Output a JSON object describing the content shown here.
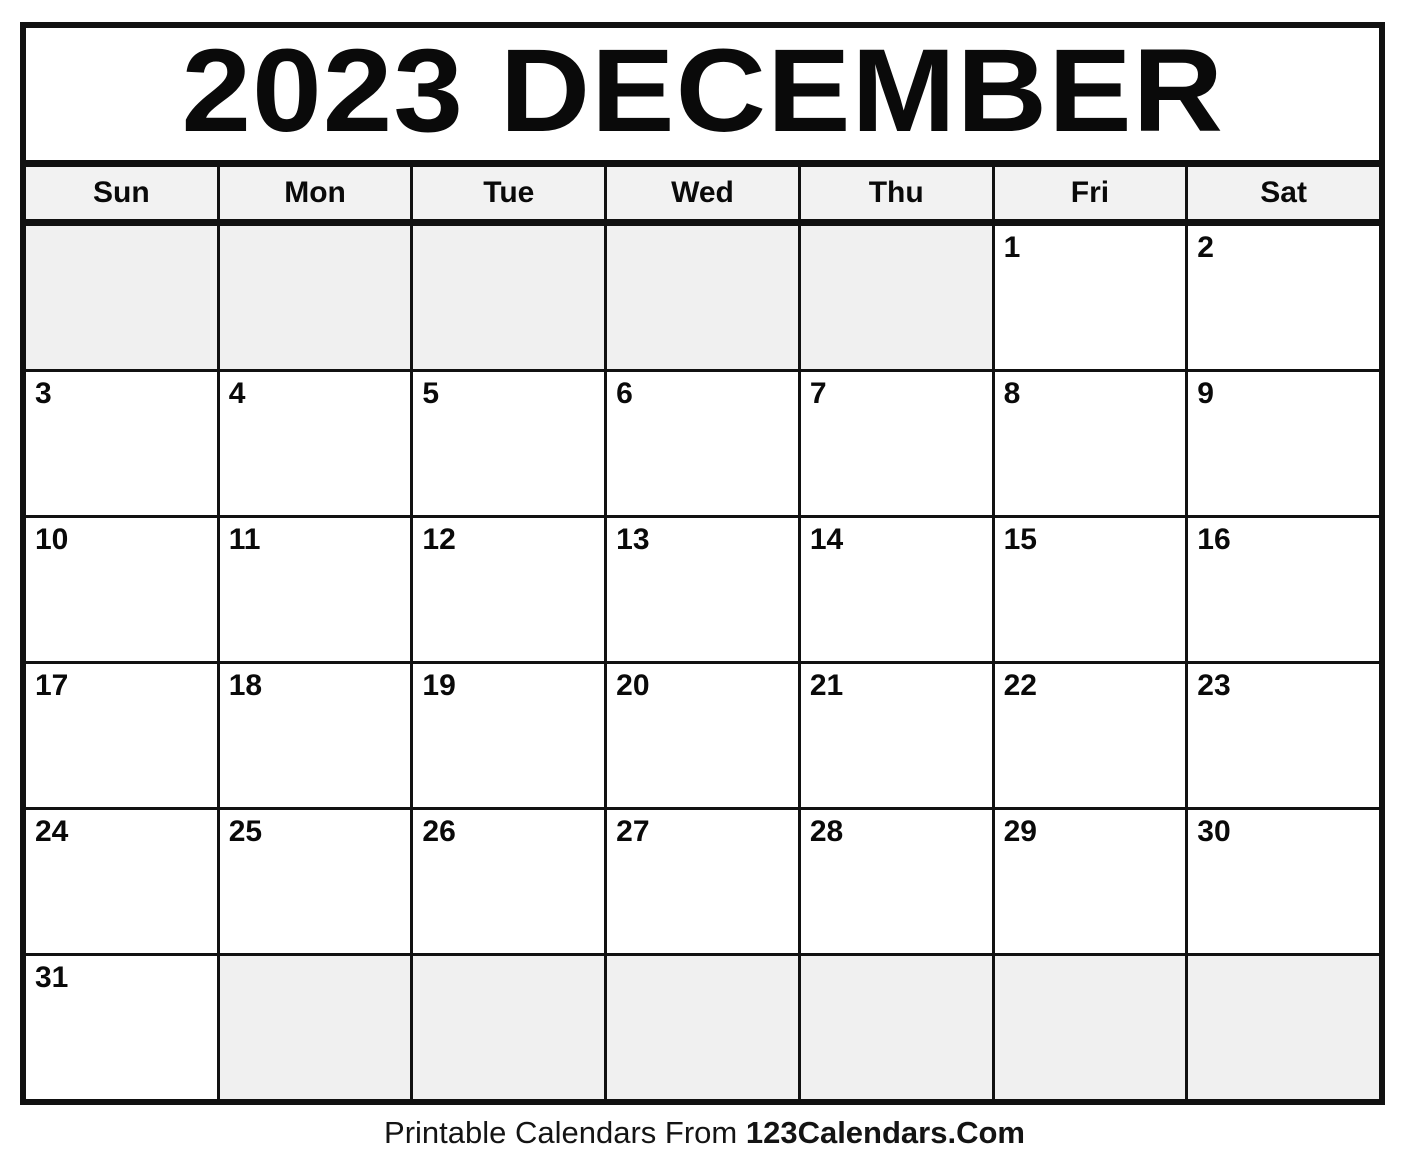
{
  "calendar": {
    "title": "2023 DECEMBER",
    "year": "2023",
    "month": "DECEMBER",
    "weekdays": [
      {
        "label": "Sun"
      },
      {
        "label": "Mon"
      },
      {
        "label": "Tue"
      },
      {
        "label": "Wed"
      },
      {
        "label": "Thu"
      },
      {
        "label": "Fri"
      },
      {
        "label": "Sat"
      }
    ],
    "weeks": [
      [
        {
          "day": "",
          "blank": true
        },
        {
          "day": "",
          "blank": true
        },
        {
          "day": "",
          "blank": true
        },
        {
          "day": "",
          "blank": true
        },
        {
          "day": "",
          "blank": true
        },
        {
          "day": "1",
          "blank": false
        },
        {
          "day": "2",
          "blank": false
        }
      ],
      [
        {
          "day": "3",
          "blank": false
        },
        {
          "day": "4",
          "blank": false
        },
        {
          "day": "5",
          "blank": false
        },
        {
          "day": "6",
          "blank": false
        },
        {
          "day": "7",
          "blank": false
        },
        {
          "day": "8",
          "blank": false
        },
        {
          "day": "9",
          "blank": false
        }
      ],
      [
        {
          "day": "10",
          "blank": false
        },
        {
          "day": "11",
          "blank": false
        },
        {
          "day": "12",
          "blank": false
        },
        {
          "day": "13",
          "blank": false
        },
        {
          "day": "14",
          "blank": false
        },
        {
          "day": "15",
          "blank": false
        },
        {
          "day": "16",
          "blank": false
        }
      ],
      [
        {
          "day": "17",
          "blank": false
        },
        {
          "day": "18",
          "blank": false
        },
        {
          "day": "19",
          "blank": false
        },
        {
          "day": "20",
          "blank": false
        },
        {
          "day": "21",
          "blank": false
        },
        {
          "day": "22",
          "blank": false
        },
        {
          "day": "23",
          "blank": false
        }
      ],
      [
        {
          "day": "24",
          "blank": false
        },
        {
          "day": "25",
          "blank": false
        },
        {
          "day": "26",
          "blank": false
        },
        {
          "day": "27",
          "blank": false
        },
        {
          "day": "28",
          "blank": false
        },
        {
          "day": "29",
          "blank": false
        },
        {
          "day": "30",
          "blank": false
        }
      ],
      [
        {
          "day": "31",
          "blank": false
        },
        {
          "day": "",
          "blank": true
        },
        {
          "day": "",
          "blank": true
        },
        {
          "day": "",
          "blank": true
        },
        {
          "day": "",
          "blank": true
        },
        {
          "day": "",
          "blank": true
        },
        {
          "day": "",
          "blank": true
        }
      ]
    ]
  },
  "footer": {
    "prefix": "Printable Calendars From ",
    "brand": "123Calendars.Com"
  },
  "colors": {
    "border": "#111111",
    "text": "#0a0a0a",
    "header_bg": "#f2f2f2",
    "blank_cell_bg": "#f0f0f0",
    "cell_bg": "#ffffff",
    "page_bg": "#ffffff"
  }
}
